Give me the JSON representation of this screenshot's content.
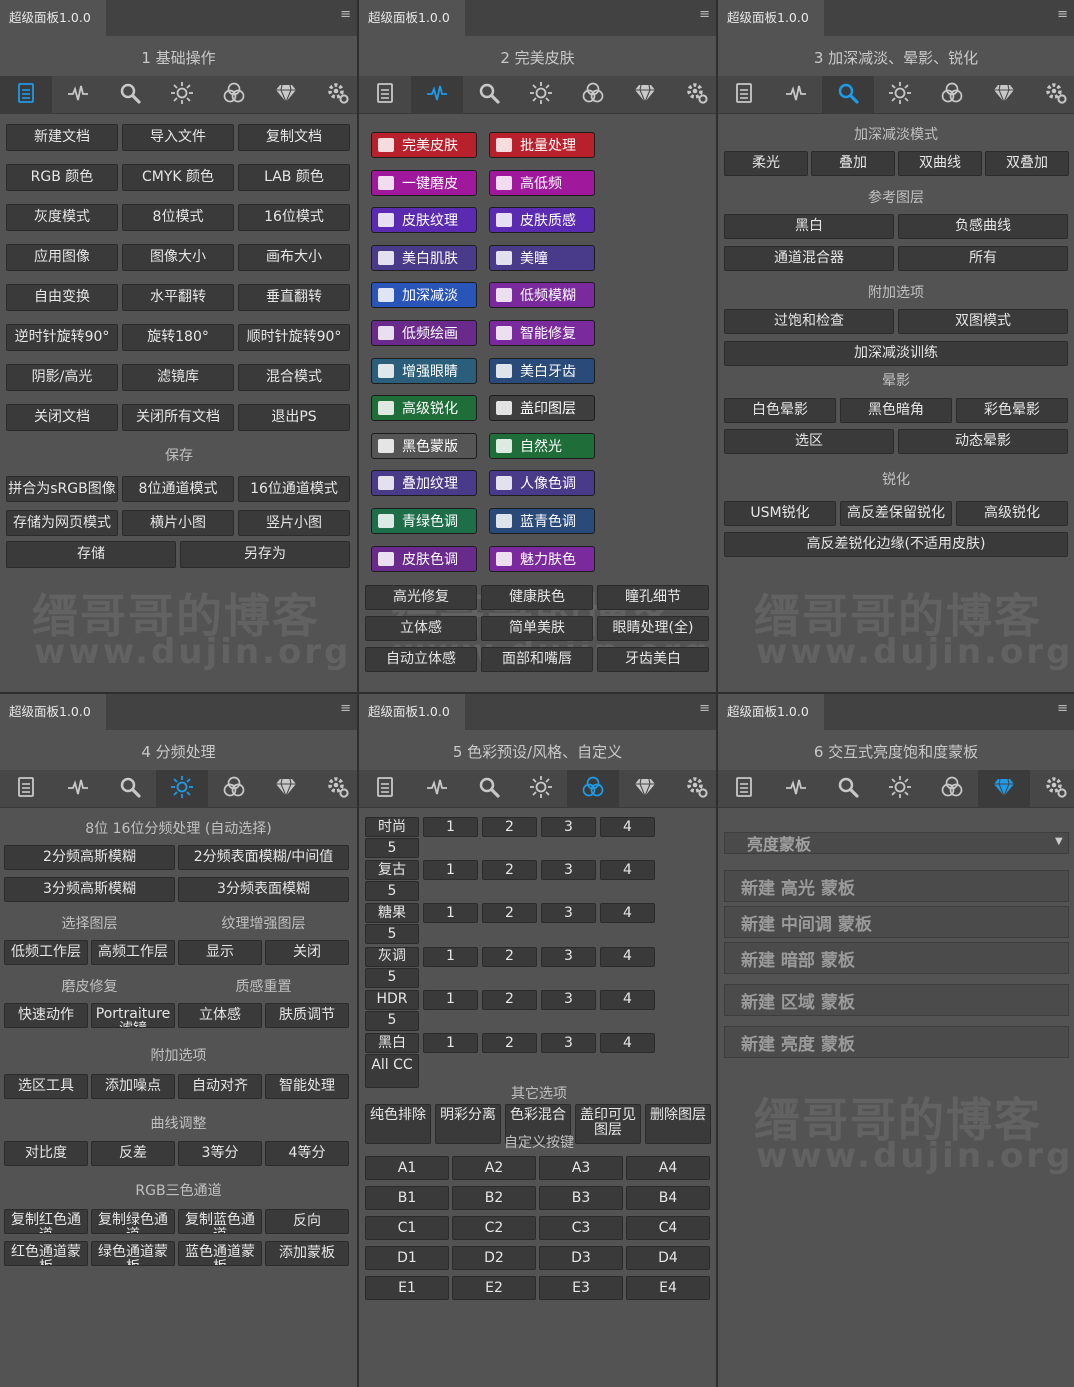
{
  "tab_title": "超级面板1.0.0",
  "menu_icon": "≡",
  "toolbar_icons": [
    "document-icon",
    "heal-icon",
    "magnifier-icon",
    "sun-icon",
    "color-circles-icon",
    "diamond-icon",
    "gear-icon"
  ],
  "accent_color": "#1e9be8",
  "watermark": {
    "line1": "缙哥哥的博客",
    "line2": "www.dujin.org"
  },
  "p1": {
    "title": "1 基础操作",
    "grid": [
      "新建文档",
      "导入文件",
      "复制文档",
      "RGB 颜色",
      "CMYK 颜色",
      "LAB 颜色",
      "灰度模式",
      "8位模式",
      "16位模式",
      "应用图像",
      "图像大小",
      "画布大小",
      "自由变换",
      "水平翻转",
      "垂直翻转",
      "逆时针旋转90°",
      "旋转180°",
      "顺时针旋转90°",
      "阴影/高光",
      "滤镜库",
      "混合模式",
      "关闭文档",
      "关闭所有文档",
      "退出PS"
    ],
    "save_label": "保存",
    "save": [
      "拼合为sRGB图像",
      "8位通道模式",
      "16位通道模式",
      "存储为网页模式",
      "横片小图",
      "竖片小图"
    ],
    "save2": [
      "存储",
      "另存为"
    ]
  },
  "p2": {
    "title": "2 完美皮肤",
    "colored": [
      {
        "label": "完美皮肤",
        "color": "#b8202c"
      },
      {
        "label": "批量处理",
        "color": "#b8202c"
      },
      {
        "label": "一键磨皮",
        "color": "#a0189c"
      },
      {
        "label": "高低频",
        "color": "#a0189c"
      },
      {
        "label": "皮肤纹理",
        "color": "#5a2bb0"
      },
      {
        "label": "皮肤质感",
        "color": "#5a2bb0"
      },
      {
        "label": "美白肌肤",
        "color": "#4a3a8a"
      },
      {
        "label": "美瞳",
        "color": "#4a3a8a"
      },
      {
        "label": "加深减淡",
        "color": "#2a55b8"
      },
      {
        "label": "低频模糊",
        "color": "#7a2a9c"
      },
      {
        "label": "低频绘画",
        "color": "#6a2a8c"
      },
      {
        "label": "智能修复",
        "color": "#7a2a9c"
      },
      {
        "label": "增强眼睛",
        "color": "#2a5e7a"
      },
      {
        "label": "美白牙齿",
        "color": "#2a4a7a"
      },
      {
        "label": "高级锐化",
        "color": "#1f6e3a"
      },
      {
        "label": "盖印图层",
        "color": "#3e3e3e"
      },
      {
        "label": "黑色蒙版",
        "color": "#555555"
      },
      {
        "label": "自然光",
        "color": "#1f6e3a"
      },
      {
        "label": "叠加纹理",
        "color": "#4a3a8a"
      },
      {
        "label": "人像色调",
        "color": "#4a3a8a"
      },
      {
        "label": "青绿色调",
        "color": "#1f6e4a"
      },
      {
        "label": "蓝青色调",
        "color": "#2a4a7a"
      },
      {
        "label": "皮肤色调",
        "color": "#6a2a8c"
      },
      {
        "label": "魅力肤色",
        "color": "#7a2a9c"
      }
    ],
    "grid": [
      "高光修复",
      "健康肤色",
      "瞳孔细节",
      "立体感",
      "简单美肤",
      "眼睛处理(全)",
      "自动立体感",
      "面部和嘴唇",
      "牙齿美白"
    ]
  },
  "p3": {
    "title": "3 加深减淡、晕影、锐化",
    "s1": "加深减淡模式",
    "b1": [
      "柔光",
      "叠加",
      "双曲线",
      "双叠加"
    ],
    "s2": "参考图层",
    "b2": [
      "黑白",
      "负感曲线",
      "通道混合器",
      "所有"
    ],
    "s3": "附加选项",
    "b3": [
      "过饱和检查",
      "双图模式",
      "加深减淡训练"
    ],
    "s4": "晕影",
    "b4": [
      "白色晕影",
      "黑色暗角",
      "彩色晕影",
      "选区",
      "动态晕影"
    ],
    "s5": "锐化",
    "b5": [
      "USM锐化",
      "高反差保留锐化",
      "高级锐化",
      "高反差锐化边缘(不适用皮肤)"
    ]
  },
  "p4": {
    "title": "4 分频处理",
    "s1": "8位 16位分频处理 (自动选择)",
    "b1": [
      "2分频高斯模糊",
      "2分频表面模糊/中间值",
      "3分频高斯模糊",
      "3分频表面模糊"
    ],
    "l2a": "选择图层",
    "l2b": "纹理增强图层",
    "b2": [
      "低频工作层",
      "高频工作层",
      "显示",
      "关闭"
    ],
    "l3a": "磨皮修复",
    "l3b": "质感重置",
    "b3": [
      "快速动作",
      "Portraiture滤镜",
      "立体感",
      "肤质调节"
    ],
    "s4": "附加选项",
    "b4": [
      "选区工具",
      "添加噪点",
      "自动对齐",
      "智能处理"
    ],
    "s5": "曲线调整",
    "b5": [
      "对比度",
      "反差",
      "3等分",
      "4等分"
    ],
    "s6": "RGB三色通道",
    "b6": [
      "复制红色通道",
      "复制绿色通道",
      "复制蓝色通道",
      "反向",
      "红色通道蒙板",
      "绿色通道蒙板",
      "蓝色通道蒙板",
      "添加蒙板"
    ]
  },
  "p5": {
    "title": "5 色彩预设/风格、自定义",
    "rows": [
      {
        "name": "时尚",
        "n": "5"
      },
      {
        "name": "复古",
        "n": "5"
      },
      {
        "name": "糖果",
        "n": "5"
      },
      {
        "name": "灰调",
        "n": "5"
      },
      {
        "name": "HDR",
        "n": "5"
      },
      {
        "name": "黑白",
        "n": "All CC"
      }
    ],
    "nums": [
      "1",
      "2",
      "3",
      "4"
    ],
    "other_label": "其它选项",
    "other": [
      "纯色排除",
      "明彩分离",
      "色彩混合",
      "盖印可见图层",
      "删除图层"
    ],
    "custom_label": "自定义按键",
    "custom": [
      "A1",
      "A2",
      "A3",
      "A4",
      "B1",
      "B2",
      "B3",
      "B4",
      "C1",
      "C2",
      "C3",
      "C4",
      "D1",
      "D2",
      "D3",
      "D4",
      "E1",
      "E2",
      "E3",
      "E4"
    ]
  },
  "p6": {
    "title": "6 交互式亮度饱和度蒙板",
    "dropdown": "亮度蒙板",
    "arrow": "▼",
    "masks": [
      "新建 高光 蒙板",
      "新建 中间调 蒙板",
      "新建 暗部 蒙板",
      "新建 区域 蒙板",
      "新建 亮度 蒙板"
    ]
  }
}
